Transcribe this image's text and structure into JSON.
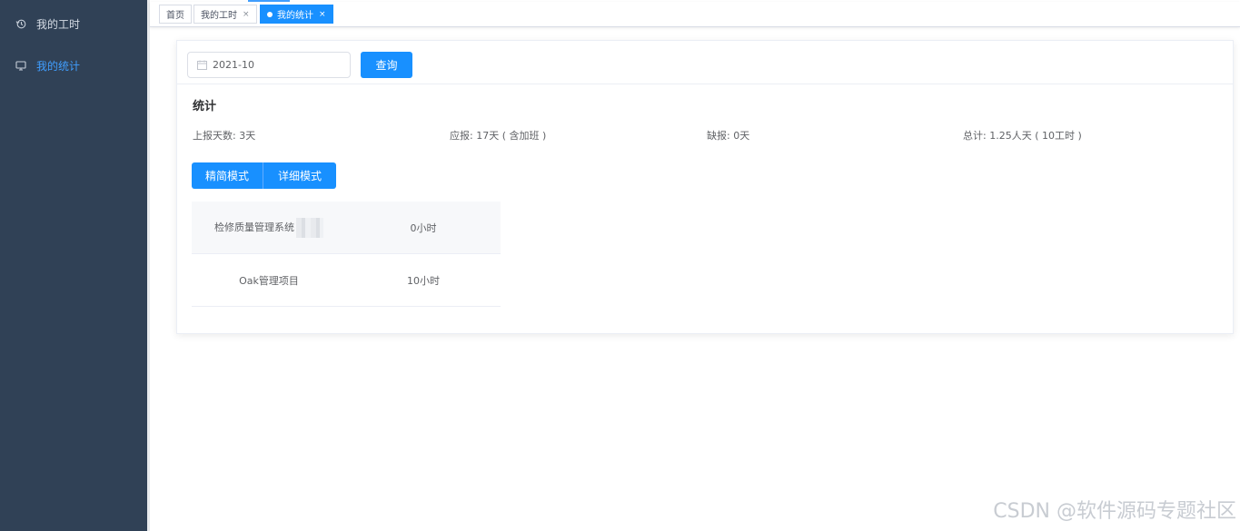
{
  "sidebar": {
    "items": [
      {
        "label": "我的工时",
        "icon": "history-icon",
        "active": false
      },
      {
        "label": "我的统计",
        "icon": "monitor-icon",
        "active": true
      }
    ]
  },
  "tags": [
    {
      "label": "首页",
      "closable": false,
      "active": false
    },
    {
      "label": "我的工时",
      "closable": true,
      "active": false
    },
    {
      "label": "我的统计",
      "closable": true,
      "active": true
    }
  ],
  "tag_close_symbol": "×",
  "query": {
    "date_value": "2021-10",
    "button_label": "查询"
  },
  "summary": {
    "title": "统计",
    "reported_days": "上报天数:  3天",
    "required": "应报:  17天 ( 含加班 )",
    "missing": "缺报:  0天",
    "total": "总计:  1.25人天 ( 10工时 )"
  },
  "modes": {
    "simple_label": "精简模式",
    "detail_label": "详细模式"
  },
  "rows": [
    {
      "name": "检修质量管理系统",
      "hours": "0小时"
    },
    {
      "name": "Oak管理项目",
      "hours": "10小时"
    }
  ],
  "watermark": "CSDN @软件源码专题社区",
  "colors": {
    "sidebar_bg": "#304156",
    "primary": "#1890ff",
    "active_text": "#409eff"
  }
}
